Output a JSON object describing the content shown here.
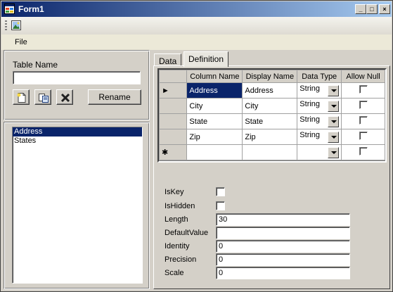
{
  "window": {
    "title": "Form1",
    "minimize_glyph": "_",
    "maximize_glyph": "□",
    "close_glyph": "×"
  },
  "toolbar": {
    "icon": "image-icon"
  },
  "menu": {
    "file": "File"
  },
  "table_panel": {
    "label": "Table Name",
    "table_name_value": "",
    "buttons": {
      "new_icon": "new-file-icon",
      "copy_icon": "copy-icon",
      "delete_icon": "delete-x-icon",
      "rename": "Rename"
    }
  },
  "tables_list": {
    "items": [
      "Address",
      "States"
    ],
    "selected": "Address"
  },
  "tabs": [
    {
      "label": "Data",
      "active": false
    },
    {
      "label": "Definition",
      "active": true
    }
  ],
  "grid": {
    "columns": [
      "Column Name",
      "Display Name",
      "Data Type",
      "Allow Null"
    ],
    "rows": [
      {
        "indicator": "►",
        "column_name": "Address",
        "display_name": "Address",
        "data_type": "String",
        "allow_null": false
      },
      {
        "indicator": "",
        "column_name": "City",
        "display_name": "City",
        "data_type": "String",
        "allow_null": false
      },
      {
        "indicator": "",
        "column_name": "State",
        "display_name": "State",
        "data_type": "String",
        "allow_null": false
      },
      {
        "indicator": "",
        "column_name": "Zip",
        "display_name": "Zip",
        "data_type": "String",
        "allow_null": false
      }
    ],
    "new_row_indicator": "✱"
  },
  "properties": {
    "is_key": {
      "label": "IsKey",
      "checked": false
    },
    "is_hidden": {
      "label": "IsHidden",
      "checked": false
    },
    "length": {
      "label": "Length",
      "value": "30"
    },
    "default_value": {
      "label": "DefaultValue",
      "value": ""
    },
    "identity": {
      "label": "Identity",
      "value": "0"
    },
    "precision": {
      "label": "Precision",
      "value": "0"
    },
    "scale": {
      "label": "Scale",
      "value": "0"
    }
  }
}
